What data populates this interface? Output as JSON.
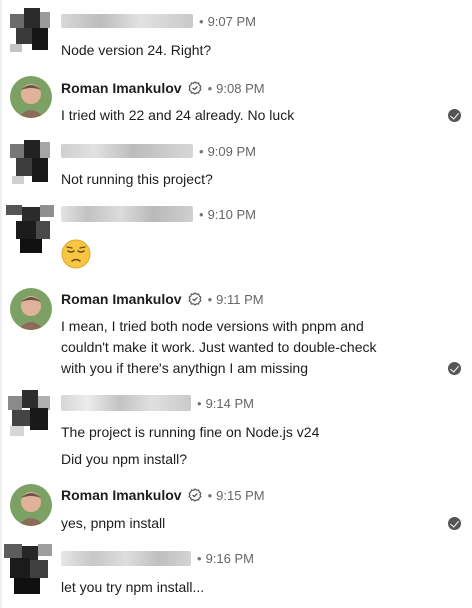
{
  "messages": [
    {
      "sender": "",
      "time": "9:07 PM",
      "lines": [
        "Node version 24. Right?"
      ],
      "read": false
    },
    {
      "sender": "Roman Imankulov",
      "time": "9:08 PM",
      "lines": [
        "I tried with 22 and 24 already. No luck"
      ],
      "read": true
    },
    {
      "sender": "",
      "time": "9:09 PM",
      "lines": [
        "Not running this project?"
      ],
      "read": false
    },
    {
      "sender": "",
      "time": "9:10 PM",
      "emoji": "pensive-face",
      "read": false
    },
    {
      "sender": "Roman Imankulov",
      "time": "9:11 PM",
      "lines": [
        "I mean, I tried both node versions with pnpm and",
        "couldn't make it work. Just wanted to double-check",
        "with you if there's anythign I am missing"
      ],
      "read": true
    },
    {
      "sender": "",
      "time": "9:14 PM",
      "lines": [
        "The project is running fine on Node.js v24",
        "Did you npm install?"
      ],
      "read": false
    },
    {
      "sender": "Roman Imankulov",
      "time": "9:15 PM",
      "lines": [
        "yes, pnpm install"
      ],
      "read": true
    },
    {
      "sender": "",
      "time": "9:16 PM",
      "lines": [
        "let you try npm install..."
      ],
      "read": false
    }
  ],
  "separator": "•",
  "icons": {
    "verified": "verified-badge-icon",
    "read": "read-check-icon",
    "emoji": "pensive-face-emoji"
  },
  "colors": {
    "text": "#1d1d1d",
    "meta": "#666666",
    "check": "#555555",
    "emoji": "#f6c542"
  }
}
